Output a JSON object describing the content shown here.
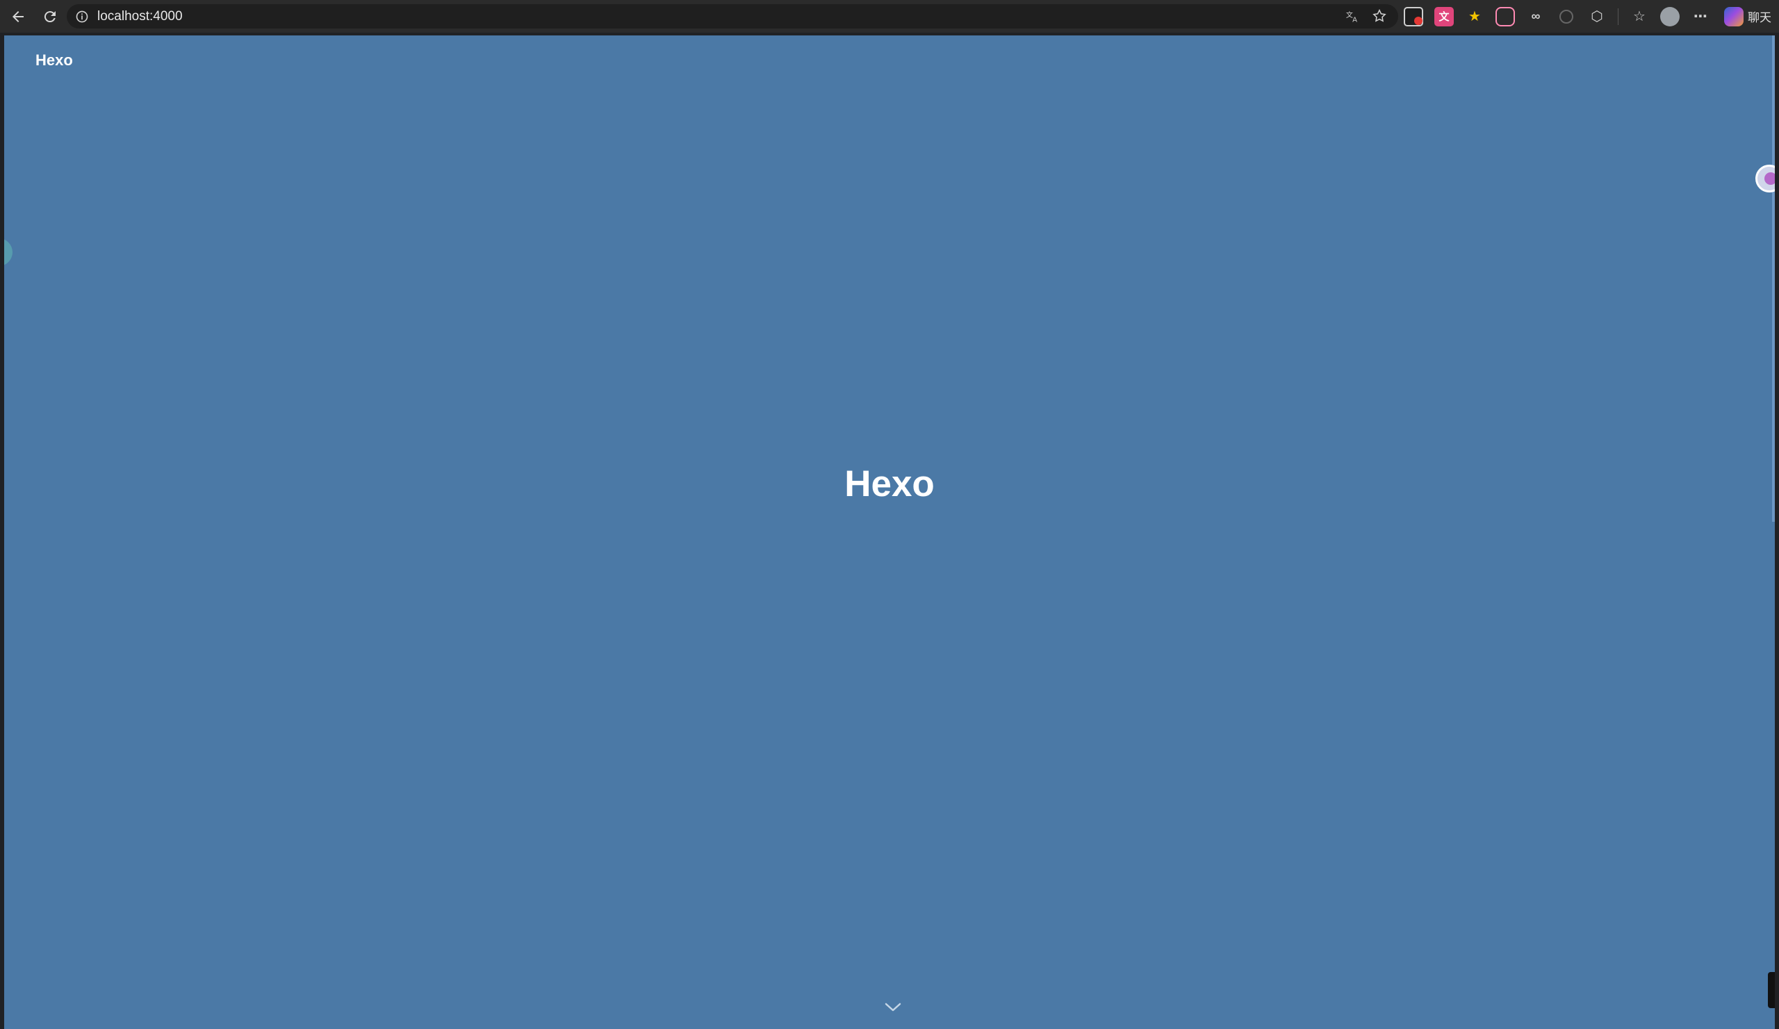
{
  "browser": {
    "url": "localhost:4000",
    "chat_label": "聊天",
    "toolbar_icons": [
      {
        "name": "translate-icon"
      },
      {
        "name": "favorite-star-icon"
      },
      {
        "name": "extension-tab-counter-icon"
      },
      {
        "name": "extension-pink-icon",
        "color": "#e0457b"
      },
      {
        "name": "extension-yellow-icon",
        "color": "#f2c300"
      },
      {
        "name": "extension-cat-icon",
        "color": "#ff8ab3"
      },
      {
        "name": "extension-glasses-icon"
      },
      {
        "name": "extension-circle-icon"
      },
      {
        "name": "extensions-puzzle-icon"
      },
      {
        "name": "favorites-list-icon"
      },
      {
        "name": "profile-avatar-icon"
      },
      {
        "name": "more-menu-icon"
      },
      {
        "name": "copilot-icon"
      }
    ]
  },
  "page": {
    "site_title": "Hexo",
    "hero_title": "Hexo",
    "background_color": "#4b79a6"
  }
}
